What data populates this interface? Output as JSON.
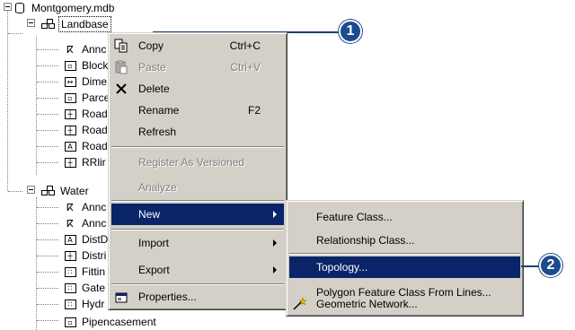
{
  "tree": {
    "root": "Montgomery.mdb",
    "landbase": {
      "label": "Landbase",
      "children": [
        "Annc",
        "Block",
        "Dime",
        "Parce",
        "Road",
        "Road",
        "Road",
        "RRlir"
      ]
    },
    "water": {
      "label": "Water",
      "children": [
        "Annc",
        "Annc",
        "DistD",
        "Distri",
        "Fittin",
        "Gate",
        "Hydr",
        "Pipencasement"
      ]
    }
  },
  "context_menu": {
    "copy": "Copy",
    "copy_accel": "Ctrl+C",
    "paste": "Paste",
    "paste_accel": "Ctrl+V",
    "delete": "Delete",
    "rename": "Rename",
    "rename_accel": "F2",
    "refresh": "Refresh",
    "register": "Register As Versioned",
    "analyze": "Analyze",
    "new": "New",
    "import": "Import",
    "export": "Export",
    "properties": "Properties..."
  },
  "submenu": {
    "feature_class": "Feature Class...",
    "relationship_class": "Relationship Class...",
    "topology": "Topology...",
    "polygon_from_lines": "Polygon Feature Class From Lines...",
    "geometric_network": "Geometric Network..."
  },
  "callouts": [
    "1",
    "2"
  ],
  "colors": {
    "highlight": "#0a246a",
    "callout": "#1c4a8c",
    "menu_face": "#d4d0c8"
  }
}
